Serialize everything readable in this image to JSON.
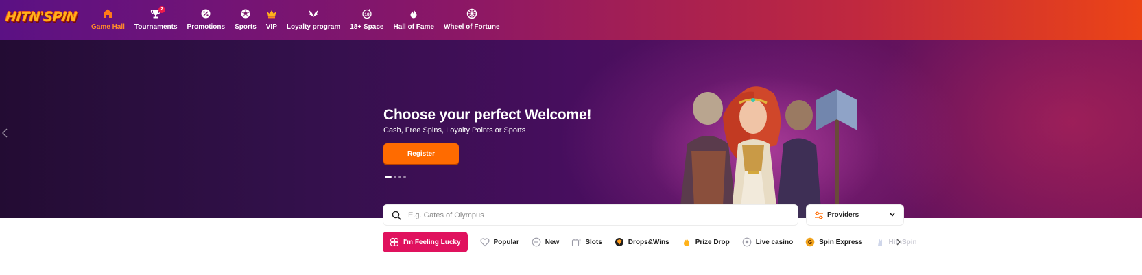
{
  "brand": {
    "logo_text": "HITN'SPIN",
    "accent": "#ff6b00",
    "lucky_color": "#e0125e"
  },
  "nav": [
    {
      "label": "Game Hall",
      "icon": "home-icon",
      "active": true
    },
    {
      "label": "Tournaments",
      "icon": "trophy-icon",
      "badge": "2"
    },
    {
      "label": "Promotions",
      "icon": "promo-icon"
    },
    {
      "label": "Sports",
      "icon": "soccer-ball-icon"
    },
    {
      "label": "VIP",
      "icon": "crown-icon"
    },
    {
      "label": "Loyalty program",
      "icon": "wings-icon"
    },
    {
      "label": "18+ Space",
      "icon": "adult-18-icon"
    },
    {
      "label": "Hall of Fame",
      "icon": "flame-icon"
    },
    {
      "label": "Wheel of Fortune",
      "icon": "wheel-icon"
    }
  ],
  "hero": {
    "title": "Choose your perfect Welcome!",
    "subtitle": "Cash, Free Spins, Loyalty Points or Sports",
    "cta": "Register",
    "slides_total": 4,
    "slide_active": 1
  },
  "search": {
    "placeholder": "E.g. Gates of Olympus",
    "value": ""
  },
  "providers": {
    "label": "Providers"
  },
  "categories": {
    "lucky": "I'm Feeling Lucky",
    "items": [
      {
        "label": "Popular",
        "icon": "heart-icon"
      },
      {
        "label": "New",
        "icon": "new-icon"
      },
      {
        "label": "Slots",
        "icon": "slots-icon"
      },
      {
        "label": "Drops&Wins",
        "icon": "drops-wins-icon"
      },
      {
        "label": "Prize Drop",
        "icon": "prize-drop-icon"
      },
      {
        "label": "Live casino",
        "icon": "live-casino-icon"
      },
      {
        "label": "Spin Express",
        "icon": "spin-express-icon"
      },
      {
        "label": "HitnSpin",
        "icon": "hitnspin-icon"
      }
    ]
  }
}
